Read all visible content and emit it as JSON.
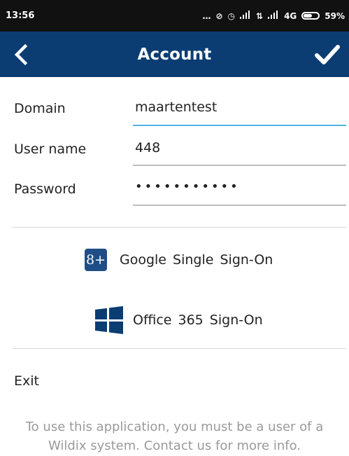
{
  "status_bar": {
    "time": "13:56",
    "network": "4G",
    "battery": "59%",
    "icons": [
      "more-dots-icon",
      "mute-icon",
      "alarm-icon",
      "signal-icon",
      "data-arrows-icon",
      "signal-icon",
      "battery-icon"
    ]
  },
  "app_bar": {
    "title": "Account",
    "back_icon": "chevron-left-icon",
    "confirm_icon": "checkmark-icon",
    "color": "#0b3d73"
  },
  "form": {
    "domain_label": "Domain",
    "domain_value": "maartentest",
    "username_label": "User name",
    "username_value": "448",
    "password_label": "Password",
    "password_value": "•••••••••••",
    "active_field_color": "#4fb3e6"
  },
  "sso": {
    "google_label": "Google Single Sign-On",
    "google_icon": "google-plus-icon",
    "google_glyph": "8+",
    "office_label": "Office 365 Sign-On",
    "office_icon": "windows-icon"
  },
  "exit_label": "Exit",
  "info_line1": "To use this application, you must be a user of a",
  "info_line2": "Wildix system. Contact us for more info."
}
